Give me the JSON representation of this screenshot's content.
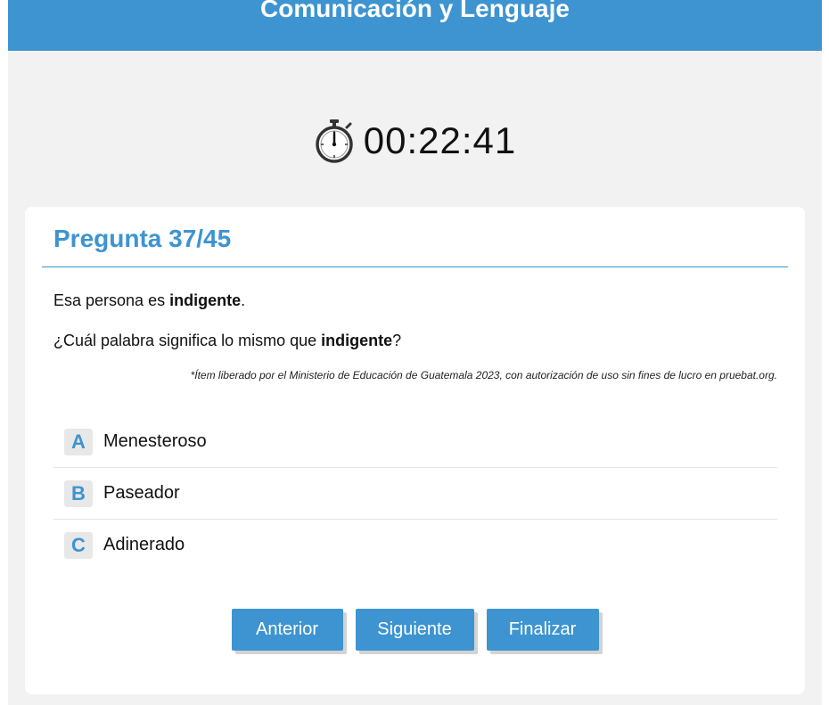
{
  "header": {
    "title": "Comunicación y Lenguaje"
  },
  "timer": {
    "value": "00:22:41",
    "icon": "stopwatch-icon"
  },
  "question": {
    "title": "Pregunta 37/45",
    "sentence_prefix": "Esa persona es ",
    "sentence_keyword": "indigente",
    "sentence_suffix": ".",
    "prompt_prefix": "¿Cuál palabra significa lo mismo que ",
    "prompt_keyword": "indigente",
    "prompt_suffix": "?",
    "credit": "*Ítem liberado por el Ministerio de Educación de Guatemala 2023, con autorización de uso sin fines de lucro en pruebat.org."
  },
  "options": [
    {
      "letter": "A",
      "text": "Menesteroso"
    },
    {
      "letter": "B",
      "text": "Paseador"
    },
    {
      "letter": "C",
      "text": "Adinerado"
    }
  ],
  "buttons": {
    "previous": "Anterior",
    "next": "Siguiente",
    "finish": "Finalizar"
  },
  "colors": {
    "accent": "#3d94d1",
    "background": "#f2f2f2",
    "card": "#ffffff"
  }
}
